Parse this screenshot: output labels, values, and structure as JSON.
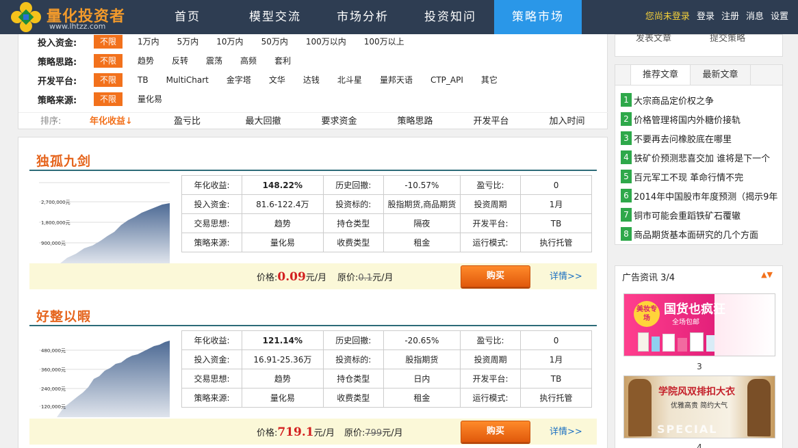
{
  "header": {
    "logo_title": "量化投资者",
    "logo_url": "www.lhtzz.com",
    "nav": [
      "首页",
      "模型交流",
      "市场分析",
      "投资知问",
      "策略市场"
    ],
    "user_links": {
      "not_logged": "您尚未登录",
      "login": "登录",
      "register": "注册",
      "messages": "消息",
      "settings": "设置"
    }
  },
  "filters": [
    {
      "label": "投入资金:",
      "options": [
        "不限",
        "1万内",
        "5万内",
        "10万内",
        "50万内",
        "100万以内",
        "100万以上"
      ]
    },
    {
      "label": "策略思路:",
      "options": [
        "不限",
        "趋势",
        "反转",
        "震荡",
        "高频",
        "套利"
      ]
    },
    {
      "label": "开发平台:",
      "options": [
        "不限",
        "TB",
        "MultiChart",
        "金字塔",
        "文华",
        "达钱",
        "北斗星",
        "量邦天语",
        "CTP_API",
        "其它"
      ]
    },
    {
      "label": "策略来源:",
      "options": [
        "不限",
        "量化易"
      ]
    }
  ],
  "sort": {
    "label": "排序:",
    "items": [
      "年化收益↓",
      "盈亏比",
      "最大回撤",
      "要求资金",
      "策略思路",
      "开发平台",
      "加入时间"
    ]
  },
  "strategies": [
    {
      "title": "独孤九剑",
      "chart_ticks": [
        "2,700,000元",
        "1,800,000元",
        "900,000元"
      ],
      "rows": [
        [
          "年化收益:",
          "148.22%",
          "历史回撤:",
          "-10.57%",
          "盈亏比:",
          "0"
        ],
        [
          "投入资金:",
          "81.6-122.4万",
          "投资标的:",
          "股指期货,商品期货",
          "投资周期",
          "1月"
        ],
        [
          "交易思想:",
          "趋势",
          "持仓类型",
          "隔夜",
          "开发平台:",
          "TB"
        ],
        [
          "策略来源:",
          "量化易",
          "收费类型",
          "租金",
          "运行模式:",
          "执行托管"
        ]
      ],
      "price_label": "价格:",
      "price": "0.09",
      "price_unit": "元/月",
      "orig_label": "原价:",
      "orig_price": "0.1",
      "orig_unit": "元/月",
      "buy": "购买",
      "detail": "详情>>"
    },
    {
      "title": "好整以暇",
      "chart_ticks": [
        "480,000元",
        "360,000元",
        "240,000元",
        "120,000元"
      ],
      "rows": [
        [
          "年化收益:",
          "121.14%",
          "历史回撤:",
          "-20.65%",
          "盈亏比:",
          "0"
        ],
        [
          "投入资金:",
          "16.91-25.36万",
          "投资标的:",
          "股指期货",
          "投资周期",
          "1月"
        ],
        [
          "交易思想:",
          "趋势",
          "持仓类型",
          "日内",
          "开发平台:",
          "TB"
        ],
        [
          "策略来源:",
          "量化易",
          "收费类型",
          "租金",
          "运行模式:",
          "执行托管"
        ]
      ],
      "price_label": "价格:",
      "price": "719.1",
      "price_unit": "元/月",
      "orig_label": "原价:",
      "orig_price": "799",
      "orig_unit": "元/月",
      "buy": "购买",
      "detail": "详情>>"
    }
  ],
  "sidebar": {
    "top_links": [
      "发表文章",
      "提交策略"
    ],
    "tabs": [
      "推荐文章",
      "最新文章"
    ],
    "articles": [
      "大宗商品定价权之争",
      "价格管理将国内外糖价接轨",
      "不要再去问橡胶底在哪里",
      "铁矿价预测悲喜交加 谁将是下一个",
      "百元军工不现 革命行情不完",
      "2014年中国股市年度预测（揭示9年",
      "铜市可能会重蹈铁矿石覆辙",
      "商品期货基本面研究的几个方面"
    ],
    "ad_title": "广告资讯 3/4",
    "ads": [
      {
        "headline": "国货也疯狂",
        "sub": "全场包邮",
        "tag": "美妆专场",
        "num": "3"
      },
      {
        "headline": "学院风双排扣大衣",
        "sub": "优雅高贵 简约大气",
        "tag": "SPECIAL",
        "num": "4"
      }
    ]
  }
}
